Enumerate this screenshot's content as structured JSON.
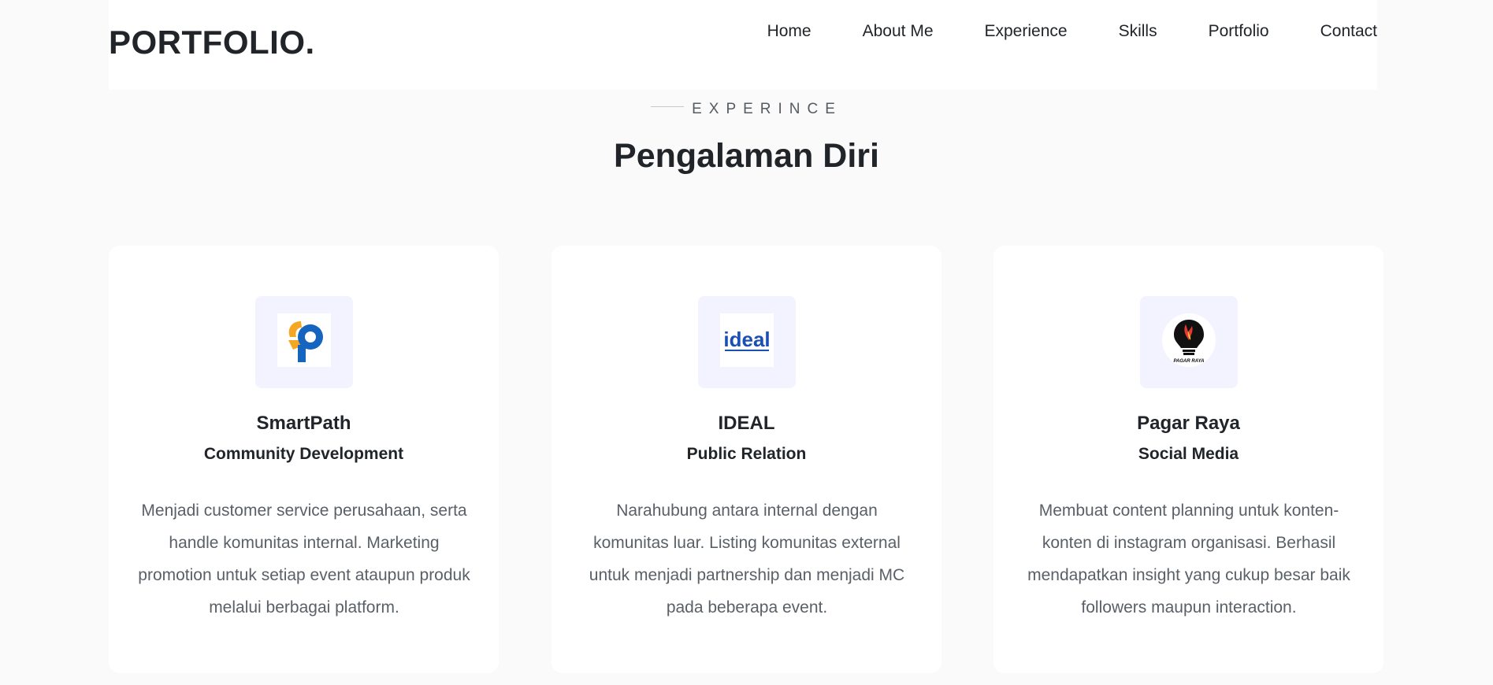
{
  "header": {
    "brand": "PORTFOLIO.",
    "nav": [
      "Home",
      "About Me",
      "Experience",
      "Skills",
      "Portfolio",
      "Contact"
    ]
  },
  "section": {
    "subtitle": "EXPERINCE",
    "title": "Pengalaman Diri"
  },
  "cards": [
    {
      "logo_icon": "smartpath-logo-icon",
      "name": "SmartPath",
      "role": "Community Development",
      "description": "Menjadi customer service perusahaan, serta handle komunitas internal. Marketing promotion untuk setiap event ataupun produk melalui berbagai platform."
    },
    {
      "logo_icon": "ideal-logo-icon",
      "logo_text": "ideal",
      "name": "IDEAL",
      "role": "Public Relation",
      "description": "Narahubung antara internal dengan komunitas luar. Listing komunitas external untuk menjadi partnership dan menjadi MC pada beberapa event."
    },
    {
      "logo_icon": "pagar-raya-logo-icon",
      "logo_text": "PAGAR RAYA",
      "name": "Pagar Raya",
      "role": "Social Media",
      "description": "Membuat content planning untuk konten-konten di instagram organisasi. Berhasil mendapatkan insight yang cukup besar baik followers maupun interaction."
    }
  ],
  "colors": {
    "page_bg": "#fafafa",
    "card_bg": "#ffffff",
    "logo_box_bg": "#f3f2ff",
    "text_dark": "#212529",
    "text_muted": "#5a6067",
    "smartpath_orange": "#f5a623",
    "smartpath_blue": "#1565c0",
    "ideal_blue": "#1a4fb4"
  }
}
